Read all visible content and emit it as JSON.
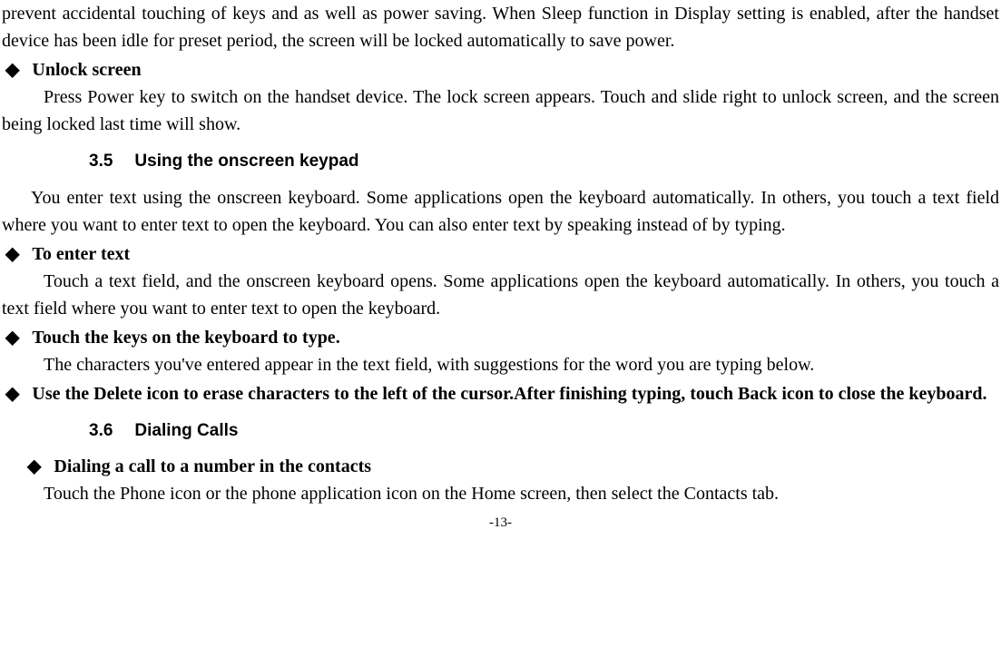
{
  "para1": "prevent accidental touching of keys and as well as power saving. When Sleep function in Display setting is enabled, after the handset device has been idle for preset period, the screen will be locked automatically to save power.",
  "bullet1": {
    "title": "Unlock screen",
    "body": "Press Power key to switch on the handset device. The lock screen appears. Touch and slide right to unlock screen, and the screen being locked last time will show."
  },
  "section35": {
    "num": "3.5",
    "title": "Using the onscreen keypad",
    "intro": "You enter text using the onscreen keyboard. Some applications open the keyboard automatically. In others, you touch a text field where you want to enter text to open the keyboard. You can also enter text by speaking instead of by typing."
  },
  "bullet2": {
    "title": "To enter text",
    "body": "Touch a text field, and the onscreen keyboard opens. Some applications open the keyboard automatically. In others, you touch a text field where you want to enter text to open the keyboard."
  },
  "bullet3": {
    "title": "Touch the keys on the keyboard to type.",
    "body": "The characters you've entered appear in the text field, with suggestions for the word you are typing below."
  },
  "bullet4": {
    "title": "Use the Delete icon to erase characters to the left of the cursor.After finishing typing, touch Back icon to close the keyboard."
  },
  "section36": {
    "num": "3.6",
    "title": "Dialing Calls"
  },
  "bullet5": {
    "title": "Dialing a call to a number in the contacts",
    "body": "Touch the Phone icon or the phone application icon on the Home screen, then select the Contacts tab."
  },
  "pageNum": "-13-"
}
